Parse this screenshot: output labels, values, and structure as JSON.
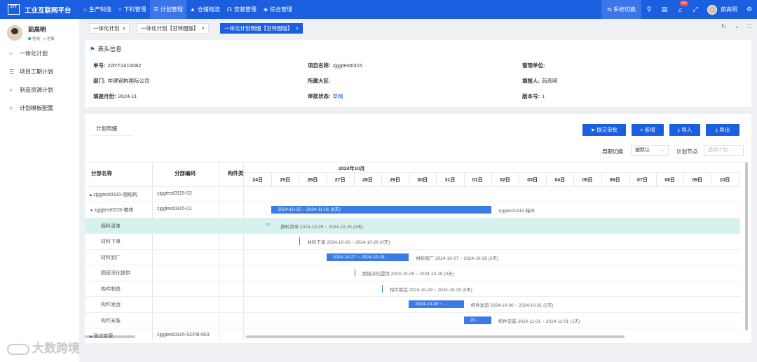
{
  "topbar": {
    "logo_mark": "ZYT",
    "app_title": "工业互联网平台",
    "menu": [
      {
        "label": "生产制造",
        "icon": "factory-icon",
        "active": false
      },
      {
        "label": "下料管理",
        "icon": "clock-icon",
        "active": false
      },
      {
        "label": "计划管理",
        "icon": "list-icon",
        "active": true
      },
      {
        "label": "仓储物流",
        "icon": "warehouse-icon",
        "active": false
      },
      {
        "label": "安装管理",
        "icon": "headset-icon",
        "active": false
      },
      {
        "label": "综合管理",
        "icon": "layers-icon",
        "active": false
      }
    ],
    "system_switch": "系统切换",
    "notification_count": "99+",
    "user_name": "茹高明"
  },
  "sidebar": {
    "user_name": "茹高明",
    "status_online": "在线",
    "logout": "注销",
    "items": [
      {
        "label": "一体化计划",
        "icon": "circle-icon"
      },
      {
        "label": "项目工期计划",
        "icon": "list-icon"
      },
      {
        "label": "制造资源计划",
        "icon": "circle-icon"
      },
      {
        "label": "计划模板配置",
        "icon": "circle-icon"
      }
    ]
  },
  "tabs": [
    {
      "label": "一体化计划",
      "active": false
    },
    {
      "label": "一体化计划【甘特图版】",
      "active": false
    },
    {
      "label": "一体化计划明细【甘特图版】",
      "active": true
    }
  ],
  "header_info": {
    "title": "表头信息",
    "fields": {
      "doc_no": {
        "label": "单号:",
        "value": "ZAYT2410082"
      },
      "project_name": {
        "label": "项目名称:",
        "value": "zjggtest0315"
      },
      "mgmt_unit": {
        "label": "管理单位:",
        "value": ""
      },
      "dept": {
        "label": "部门:",
        "value": "中建钢构国际公司"
      },
      "region": {
        "label": "所属大区:",
        "value": ""
      },
      "reporter": {
        "label": "填报人:",
        "value": "茹高明"
      },
      "month": {
        "label": "填报月份:",
        "value": "2024-11"
      },
      "approval": {
        "label": "审批状态:",
        "value": "草稿"
      },
      "version": {
        "label": "版本号:",
        "value": "1"
      }
    }
  },
  "plan": {
    "title": "计划明细",
    "buttons": {
      "submit": "提交审批",
      "add": "新增",
      "import": "导入",
      "export": "导出"
    },
    "period_label": "周期切换:",
    "period_value": "按默认",
    "node_label": "计划节点:",
    "node_placeholder": "选择计划...",
    "columns": {
      "part_name": "分部名称",
      "part_code": "分部编码",
      "component": "构件类"
    },
    "month_header": "2024年10月",
    "days": [
      "24日",
      "25日",
      "26日",
      "27日",
      "28日",
      "29日",
      "30日",
      "31日",
      "01日",
      "02日",
      "03日",
      "04日",
      "05日",
      "06日",
      "07日",
      "08日",
      "09日",
      "10日"
    ],
    "rows": [
      {
        "name": "zjggtest0315-钢结构",
        "code": "zjggtest0315-02",
        "expand": "▶",
        "indent": false,
        "highlight": false,
        "task": null
      },
      {
        "name": "zjggtest0315-箱体",
        "code": "zjggtest0315-01",
        "expand": "▼",
        "indent": false,
        "highlight": false,
        "task": {
          "type": "bar",
          "start": 1,
          "dur": 8,
          "text": "2024-10-25 ~ 2024-11-01 (8天)",
          "label": "zjggtest0315-箱体"
        }
      },
      {
        "name": "摘料清单",
        "code": "",
        "expand": "",
        "indent": true,
        "highlight": true,
        "task": {
          "type": "milestone",
          "start": 1,
          "dur": 0,
          "text": "",
          "label": "摘料清单 2024-10-25 ~ 2024-10-25 (0天)"
        }
      },
      {
        "name": "材料下单",
        "code": "",
        "expand": "",
        "indent": true,
        "highlight": false,
        "task": {
          "type": "mark",
          "start": 2,
          "dur": 0,
          "text": "",
          "label": "材料下单 2024-10-26 ~ 2024-10-26 (0天)"
        }
      },
      {
        "name": "材料到厂",
        "code": "",
        "expand": "",
        "indent": true,
        "highlight": false,
        "task": {
          "type": "bar",
          "start": 3,
          "dur": 3,
          "text": "2024-10-27 ~ 2024-10-29...",
          "label": "材料到厂 2024-10-27 ~ 2024-10-29 (3天)"
        }
      },
      {
        "name": "图纸深化提供",
        "code": "",
        "expand": "",
        "indent": true,
        "highlight": false,
        "task": {
          "type": "mark",
          "start": 4,
          "dur": 0,
          "text": "",
          "label": "图纸深化提供 2024-10-28 ~ 2024-10-28 (0天)"
        }
      },
      {
        "name": "构件制造",
        "code": "",
        "expand": "",
        "indent": true,
        "highlight": false,
        "task": {
          "type": "mark",
          "start": 5,
          "dur": 0,
          "text": "",
          "label": "构件制造 2024-10-29 ~ 2024-10-29 (0天)"
        }
      },
      {
        "name": "构件发运",
        "code": "",
        "expand": "",
        "indent": true,
        "highlight": false,
        "task": {
          "type": "bar",
          "start": 6,
          "dur": 2,
          "text": "2024-10-30 ~ ...",
          "label": "构件发运 2024-10-30 ~ 2024-10-31 (2天)"
        }
      },
      {
        "name": "构件安装",
        "code": "",
        "expand": "",
        "indent": true,
        "highlight": false,
        "task": {
          "type": "bar",
          "start": 8,
          "dur": 1,
          "text": "20...",
          "label": "构件安装 2024-11-01 ~ 2024-11-01 (1天)"
        }
      },
      {
        "name": "测试变更",
        "code": "zjggtest0315-SCFB-003",
        "expand": "▶",
        "indent": false,
        "highlight": false,
        "task": null
      }
    ]
  },
  "watermark": "大数跨境"
}
